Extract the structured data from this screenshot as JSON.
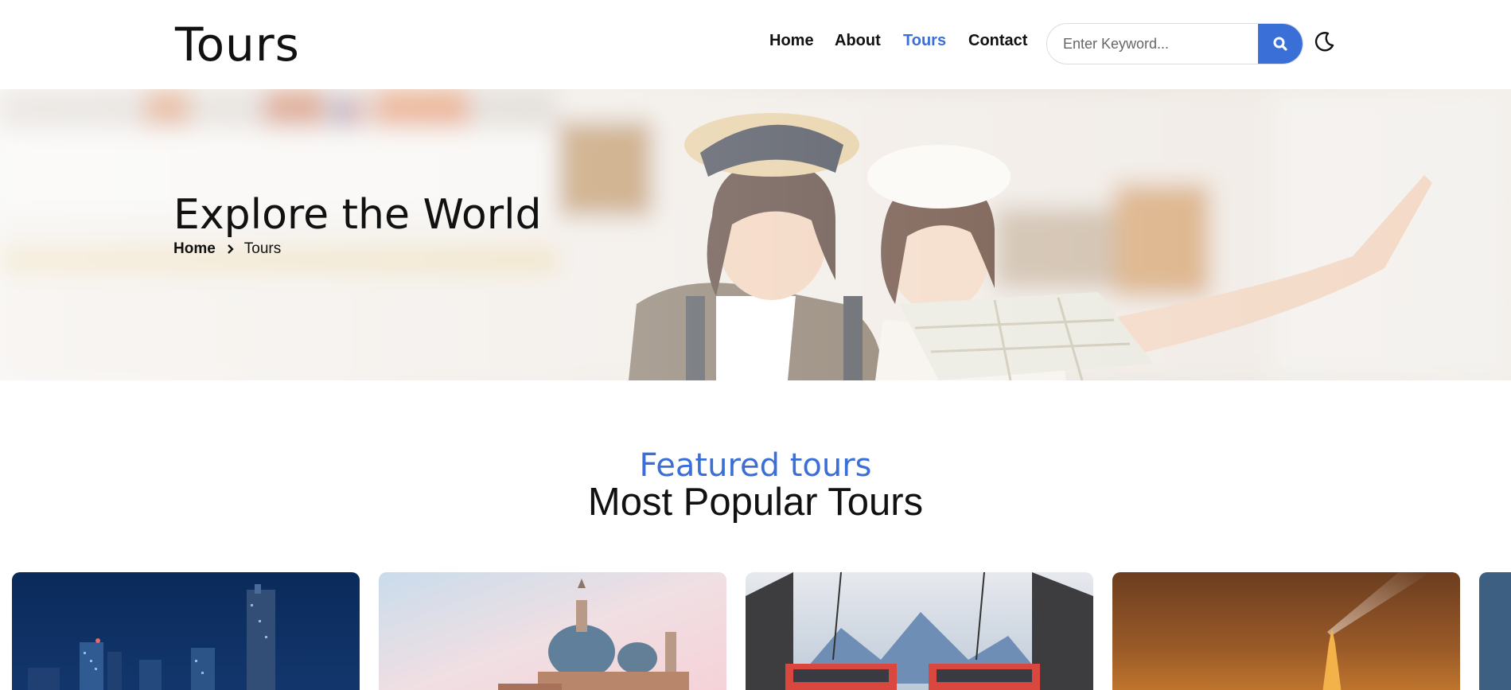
{
  "header": {
    "logo": "Tours",
    "nav": [
      {
        "label": "Home",
        "active": false
      },
      {
        "label": "About",
        "active": false
      },
      {
        "label": "Tours",
        "active": true
      },
      {
        "label": "Contact",
        "active": false
      }
    ],
    "search": {
      "placeholder": "Enter Keyword...",
      "value": ""
    },
    "search_icon": "search-icon",
    "theme_icon": "moon-icon"
  },
  "hero": {
    "title": "Explore the World",
    "breadcrumb": {
      "home": "Home",
      "current": "Tours"
    }
  },
  "section": {
    "subtitle": "Featured tours",
    "title": "Most Popular Tours"
  },
  "cards": [
    {
      "image": "city-skyline-night"
    },
    {
      "image": "venice-cathedral"
    },
    {
      "image": "mountain-train-station"
    },
    {
      "image": "paris-eiffel-night"
    },
    {
      "image": "partial-card"
    }
  ],
  "colors": {
    "accent": "#3b6fd8",
    "text": "#111111"
  }
}
